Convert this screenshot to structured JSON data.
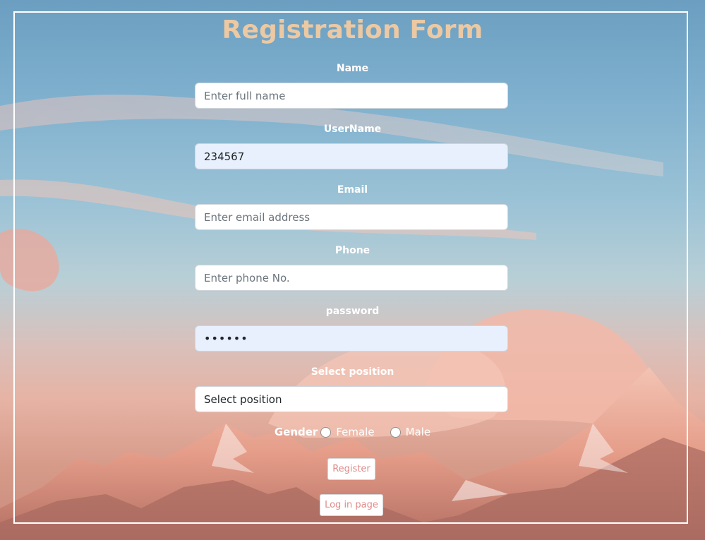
{
  "form": {
    "title": "Registration Form",
    "name": {
      "label": "Name",
      "placeholder": "Enter full name",
      "value": ""
    },
    "username": {
      "label": "UserName",
      "placeholder": "",
      "value": "234567"
    },
    "email": {
      "label": "Email",
      "placeholder": "Enter email address",
      "value": ""
    },
    "phone": {
      "label": "Phone",
      "placeholder": "Enter phone No.",
      "value": ""
    },
    "password": {
      "label": "password",
      "value": "••••••"
    },
    "position": {
      "label": "Select position",
      "selected": "Select position"
    },
    "gender": {
      "label": "Gender",
      "options": [
        "Female",
        "Male"
      ]
    },
    "register_label": "Register",
    "login_label": "Log in page"
  },
  "colors": {
    "title": "#ecc9a3",
    "button_text": "#e08a88",
    "autofill_bg": "#e8f0fe"
  }
}
